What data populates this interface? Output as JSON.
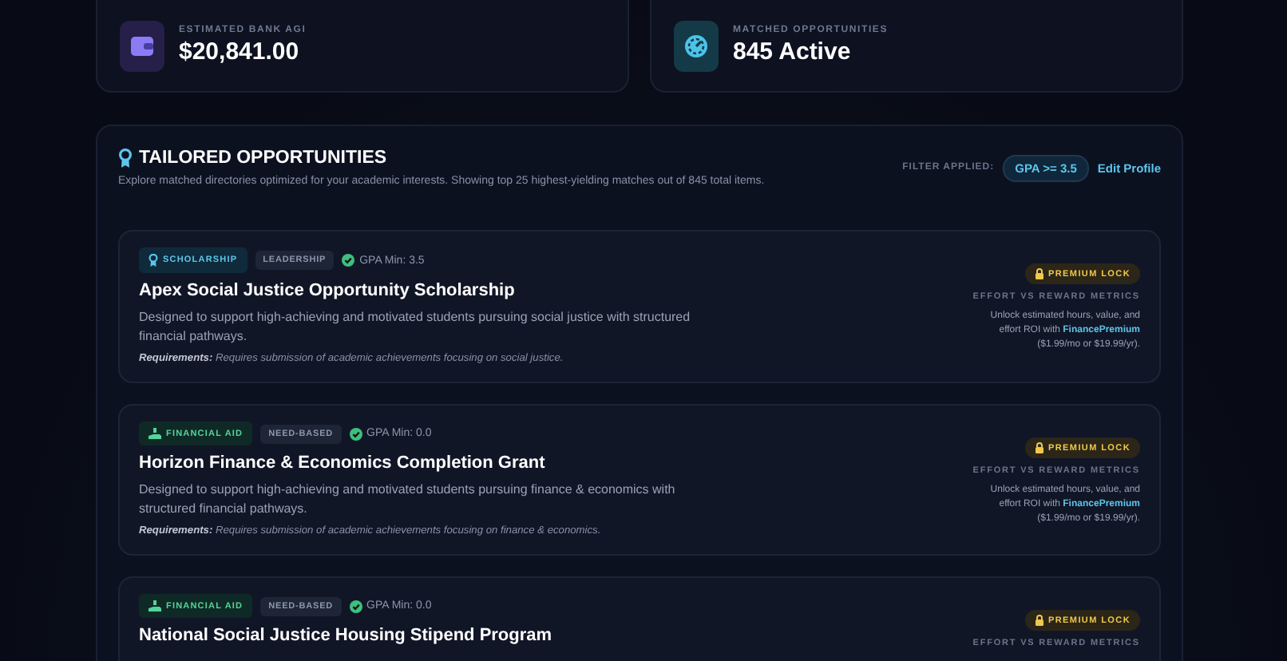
{
  "stats": [
    {
      "label": "ESTIMATED BANK AGI",
      "value": "$20,841.00"
    },
    {
      "label": "MATCHED OPPORTUNITIES",
      "value": "845 Active"
    }
  ],
  "section": {
    "title": "TAILORED OPPORTUNITIES",
    "subtitle": "Explore matched directories optimized for your academic interests. Showing top 25 highest-yielding matches out of 845 total items.",
    "filter_label": "FILTER APPLIED:",
    "filter_value": "GPA >= 3.5",
    "edit_link": "Edit Profile"
  },
  "opportunities": [
    {
      "kind": "scholarship",
      "type_label": "SCHOLARSHIP",
      "category": "LEADERSHIP",
      "gpa": "GPA Min: 3.5",
      "title": "Apex Social Justice Opportunity Scholarship",
      "description": "Designed to support high-achieving and motivated students pursuing social justice with structured financial pathways.",
      "requirements": "**Requirements:** Requires submission of academic achievements focusing on social justice.",
      "lock_label": "PREMIUM LOCK",
      "metrics_heading": "EFFORT VS REWARD METRICS",
      "metrics_text": "Unlock estimated hours, value, and effort ROI with **FinancePremium** ($1.99/mo or $19.99/yr)."
    },
    {
      "kind": "financial_aid",
      "type_label": "FINANCIAL AID",
      "category": "NEED-BASED",
      "gpa": "GPA Min: 0.0",
      "title": "Horizon Finance & Economics Completion Grant",
      "description": "Designed to support high-achieving and motivated students pursuing finance & economics with structured financial pathways.",
      "requirements": "**Requirements:** Requires submission of academic achievements focusing on finance & economics.",
      "lock_label": "PREMIUM LOCK",
      "metrics_heading": "EFFORT VS REWARD METRICS",
      "metrics_text": "Unlock estimated hours, value, and effort ROI with **FinancePremium** ($1.99/mo or $19.99/yr)."
    },
    {
      "kind": "financial_aid",
      "type_label": "FINANCIAL AID",
      "category": "NEED-BASED",
      "gpa": "GPA Min: 0.0",
      "title": "National Social Justice Housing Stipend Program",
      "lock_label": "PREMIUM LOCK",
      "metrics_heading": "EFFORT VS REWARD METRICS"
    }
  ]
}
